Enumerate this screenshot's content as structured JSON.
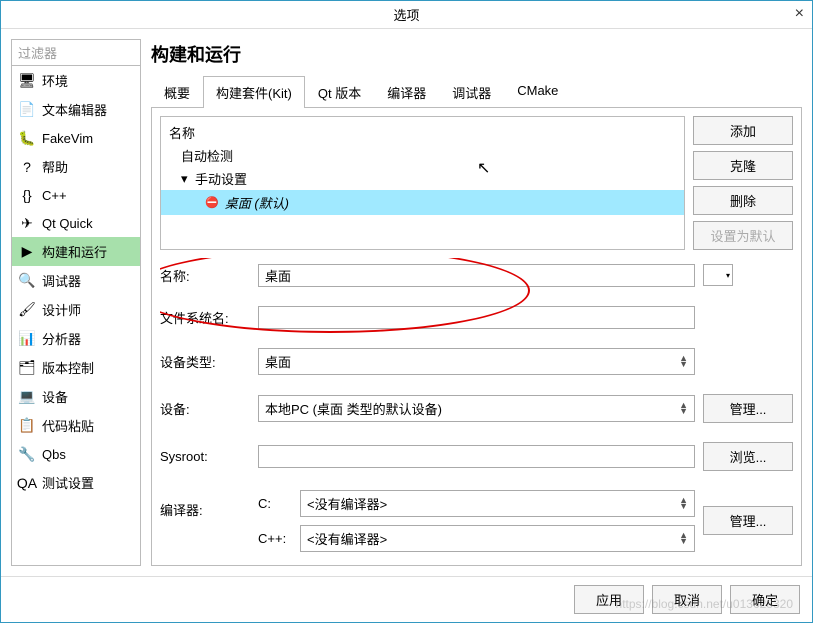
{
  "window": {
    "title": "选项",
    "close_glyph": "×"
  },
  "filter_placeholder": "过滤器",
  "sidebar": [
    {
      "label": "环境",
      "icon": "🖥"
    },
    {
      "label": "文本编辑器",
      "icon": "📄"
    },
    {
      "label": "FakeVim",
      "icon": "🐛"
    },
    {
      "label": "帮助",
      "icon": "?"
    },
    {
      "label": "C++",
      "icon": "{}"
    },
    {
      "label": "Qt Quick",
      "icon": "✈"
    },
    {
      "label": "构建和运行",
      "icon": "▶",
      "active": true
    },
    {
      "label": "调试器",
      "icon": "🔍"
    },
    {
      "label": "设计师",
      "icon": "🖌"
    },
    {
      "label": "分析器",
      "icon": "📊"
    },
    {
      "label": "版本控制",
      "icon": "🗂"
    },
    {
      "label": "设备",
      "icon": "💻"
    },
    {
      "label": "代码粘贴",
      "icon": "📋"
    },
    {
      "label": "Qbs",
      "icon": "🔧"
    },
    {
      "label": "测试设置",
      "icon": "QA"
    }
  ],
  "page_title": "构建和运行",
  "tabs": [
    "概要",
    "构建套件(Kit)",
    "Qt 版本",
    "编译器",
    "调试器",
    "CMake"
  ],
  "active_tab": 1,
  "kitlist": {
    "header": "名称",
    "auto": "自动检测",
    "manual": "手动设置",
    "kit": "桌面 (默认)"
  },
  "buttons": {
    "add": "添加",
    "clone": "克隆",
    "delete": "删除",
    "setdefault": "设置为默认",
    "manage": "管理...",
    "browse": "浏览..."
  },
  "form": {
    "name_lbl": "名称:",
    "name_val": "桌面",
    "fsname_lbl": "文件系统名:",
    "fsname_val": "",
    "devtype_lbl": "设备类型:",
    "devtype_val": "桌面",
    "device_lbl": "设备:",
    "device_val": "本地PC (桌面 类型的默认设备)",
    "sysroot_lbl": "Sysroot:",
    "sysroot_val": "",
    "compiler_lbl": "编译器:",
    "c_lbl": "C:",
    "c_val": "<没有编译器>",
    "cpp_lbl": "C++:",
    "cpp_val": "<没有编译器>"
  },
  "footer": {
    "apply": "应用",
    "cancel": "取消",
    "ok": "确定"
  },
  "watermark": "https://blog.csdn.net/u013628320"
}
